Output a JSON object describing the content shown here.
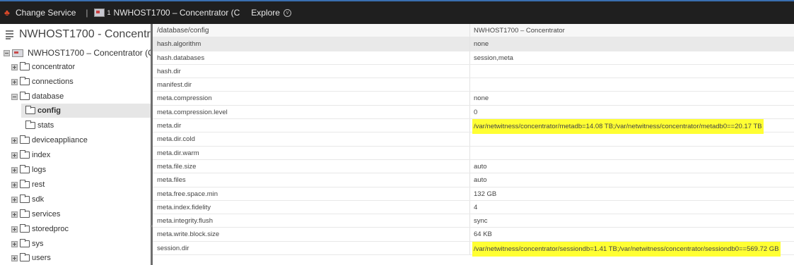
{
  "toolbar": {
    "change_service_label": "Change Service",
    "separator": "|",
    "tab_prefix": "1",
    "tab_label": "NWHOST1700 – Concentrator (C",
    "explore_label": "Explore"
  },
  "tree": {
    "title": "NWHOST1700 - Concentra",
    "root_label": "NWHOST1700 – Concentrator (C",
    "nodes": [
      {
        "label": "concentrator"
      },
      {
        "label": "connections"
      },
      {
        "label": "database"
      },
      {
        "label": "config"
      },
      {
        "label": "stats"
      },
      {
        "label": "deviceappliance"
      },
      {
        "label": "index"
      },
      {
        "label": "logs"
      },
      {
        "label": "rest"
      },
      {
        "label": "sdk"
      },
      {
        "label": "services"
      },
      {
        "label": "storedproc"
      },
      {
        "label": "sys"
      },
      {
        "label": "users"
      }
    ]
  },
  "table": {
    "header": {
      "path": "/database/config",
      "service": "NWHOST1700 – Concentrator"
    },
    "rows": [
      {
        "key": "hash.algorithm",
        "value": "none"
      },
      {
        "key": "hash.databases",
        "value": "session,meta"
      },
      {
        "key": "hash.dir",
        "value": ""
      },
      {
        "key": "manifest.dir",
        "value": ""
      },
      {
        "key": "meta.compression",
        "value": "none"
      },
      {
        "key": "meta.compression.level",
        "value": "0"
      },
      {
        "key": "meta.dir",
        "value": "/var/netwitness/concentrator/metadb=14.08 TB;/var/netwitness/concentrator/metadb0==20.17 TB"
      },
      {
        "key": "meta.dir.cold",
        "value": ""
      },
      {
        "key": "meta.dir.warm",
        "value": ""
      },
      {
        "key": "meta.file.size",
        "value": "auto"
      },
      {
        "key": "meta.files",
        "value": "auto"
      },
      {
        "key": "meta.free.space.min",
        "value": "132 GB"
      },
      {
        "key": "meta.index.fidelity",
        "value": "4"
      },
      {
        "key": "meta.integrity.flush",
        "value": "sync"
      },
      {
        "key": "meta.write.block.size",
        "value": "64 KB"
      },
      {
        "key": "session.dir",
        "value": "/var/netwitness/concentrator/sessiondb=1.41 TB;/var/netwitness/concentrator/sessiondb0==569.72 GB"
      }
    ]
  },
  "colors": {
    "toolbar_bg": "#1f1f1f",
    "highlight": "#ffff33",
    "selected_row": "#e9e9e9"
  }
}
